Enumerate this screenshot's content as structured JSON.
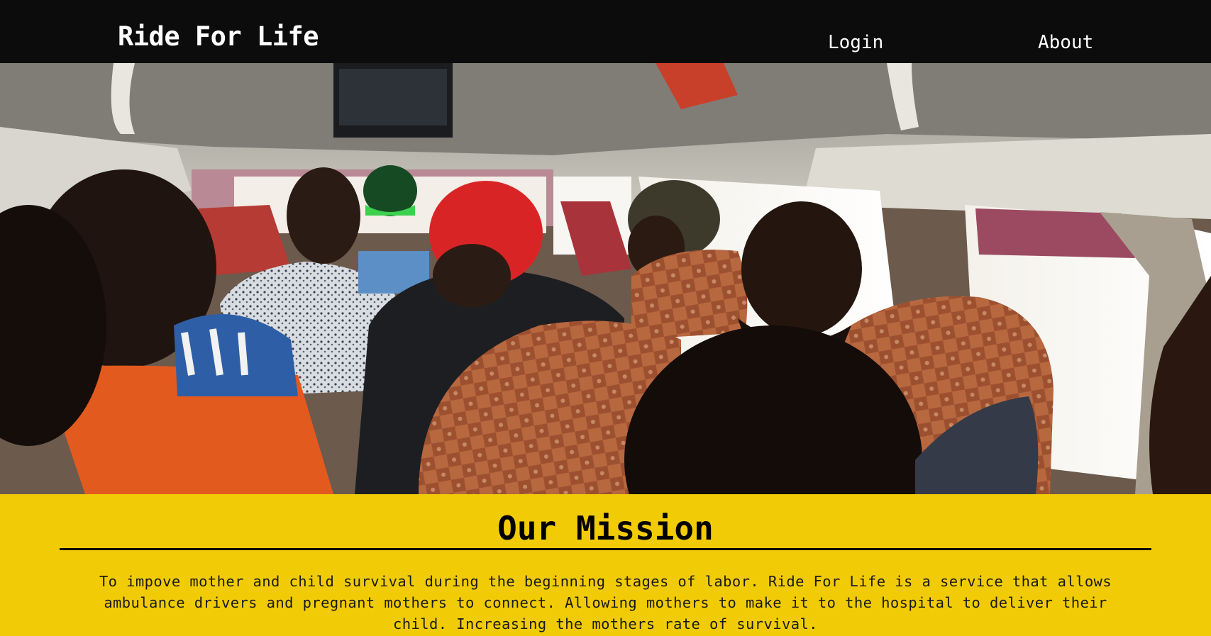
{
  "header": {
    "brand": "Ride For Life",
    "nav": {
      "login_label": "Login",
      "about_label": "About"
    }
  },
  "hero": {
    "image_subject": "passengers seated inside a minibus"
  },
  "mission": {
    "title": "Our Mission",
    "text": "To impove mother and child survival during the beginning stages of labor. Ride For Life is a service that allows ambulance drivers and pregnant mothers to connect. Allowing mothers to make it to the hospital to deliver their child. Increasing the mothers rate of survival."
  },
  "colors": {
    "navbar_bg": "#0c0c0c",
    "nav_text": "#ffffff",
    "mission_bg": "#f1cc06",
    "mission_text": "#1a1a1a"
  }
}
